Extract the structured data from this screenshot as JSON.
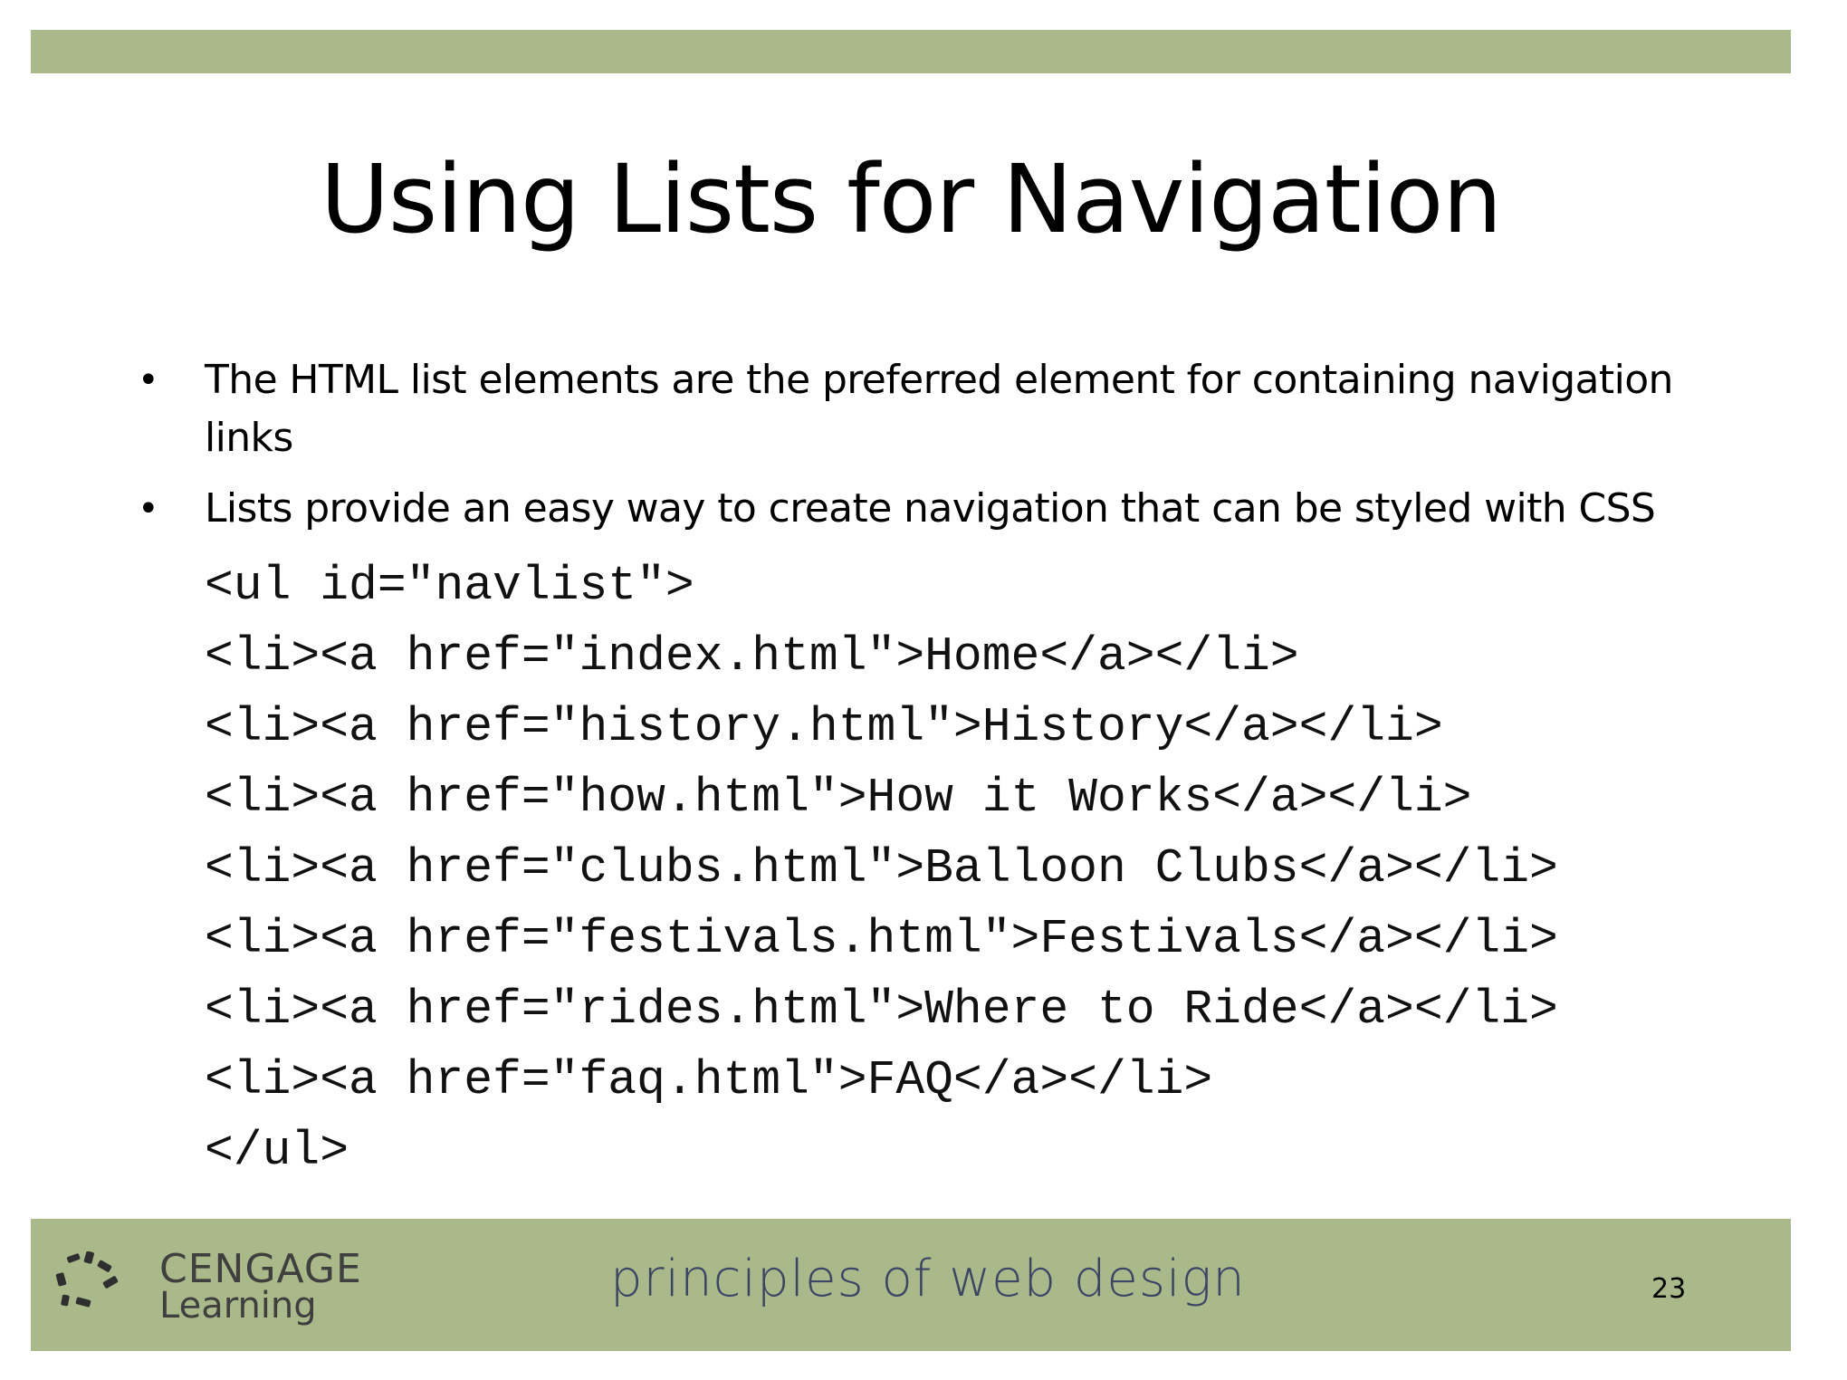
{
  "slide": {
    "title": "Using Lists for Navigation",
    "bullets": [
      "The HTML list elements are the preferred element for containing navigation links",
      "Lists provide an easy way to create navigation that can be styled with CSS"
    ],
    "code_lines": [
      "<ul id=\"navlist\">",
      "<li><a href=\"index.html\">Home</a></li>",
      "<li><a href=\"history.html\">History</a></li>",
      "<li><a href=\"how.html\">How it Works</a></li>",
      "<li><a href=\"clubs.html\">Balloon Clubs</a></li>",
      "<li><a href=\"festivals.html\">Festivals</a></li>",
      "<li><a href=\"rides.html\">Where to Ride</a></li>",
      "<li><a href=\"faq.html\">FAQ</a></li>",
      "</ul>"
    ]
  },
  "footer": {
    "logo_line1": "CENGAGE",
    "logo_line2": "Learning",
    "tagline": "principles of web design",
    "page_number": "23"
  },
  "colors": {
    "bar": "#aab98a",
    "tagline": "#3d4566",
    "logo_mark": "#2f2f2f"
  },
  "icons": {
    "logo_mark": "cengage-logo-icon"
  }
}
